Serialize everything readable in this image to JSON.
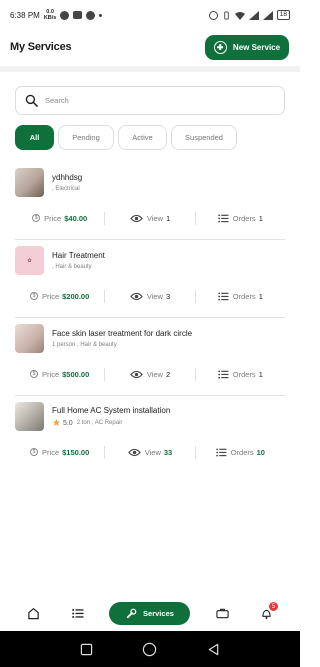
{
  "status_bar": {
    "time": "6:38",
    "period": "PM",
    "net_speed_value": "0.0",
    "net_speed_unit": "KB/s",
    "battery": "18"
  },
  "header": {
    "title": "My Services",
    "new_service_label": "New Service"
  },
  "search": {
    "placeholder": "Search",
    "value": ""
  },
  "tabs": [
    {
      "label": "All",
      "active": true
    },
    {
      "label": "Pending",
      "active": false
    },
    {
      "label": "Active",
      "active": false
    },
    {
      "label": "Suspended",
      "active": false
    }
  ],
  "services": [
    {
      "name": "ydhhdsg",
      "meta": ", Electrical",
      "rating": "",
      "price_label": "Price",
      "price": "$40.00",
      "view_label": "View",
      "views": "1",
      "orders_label": "Orders",
      "orders": "1"
    },
    {
      "name": "Hair Treatment",
      "meta": ", Hair & beauty",
      "rating": "",
      "price_label": "Price",
      "price": "$200.00",
      "view_label": "View",
      "views": "3",
      "orders_label": "Orders",
      "orders": "1"
    },
    {
      "name": "Face skin laser treatment for dark circle",
      "meta": "1 person , Hair & beauty",
      "rating": "",
      "price_label": "Price",
      "price": "$500.00",
      "view_label": "View",
      "views": "2",
      "orders_label": "Orders",
      "orders": "1"
    },
    {
      "name": "Full Home AC System installation",
      "meta": "2 ton , AC Repair",
      "rating": "5.0",
      "price_label": "Price",
      "price": "$150.00",
      "view_label": "View",
      "views": "33",
      "orders_label": "Orders",
      "orders": "10"
    }
  ],
  "bottom_nav": {
    "services_label": "Services",
    "notification_count": "5"
  },
  "colors": {
    "brand": "#10703c",
    "badge": "#e53935",
    "star": "#f3a63a"
  }
}
